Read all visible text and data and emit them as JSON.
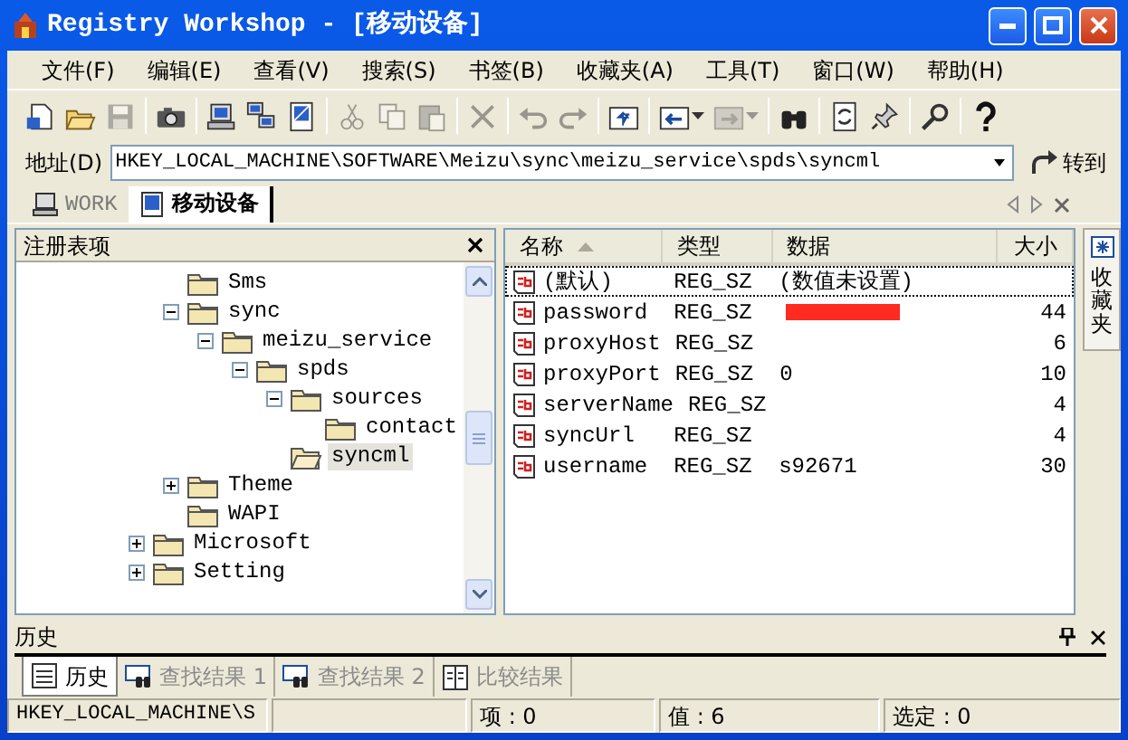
{
  "window": {
    "title": "Registry Workshop - [移动设备]"
  },
  "menu": [
    "文件(F)",
    "编辑(E)",
    "查看(V)",
    "搜索(S)",
    "书签(B)",
    "收藏夹(A)",
    "工具(T)",
    "窗口(W)",
    "帮助(H)"
  ],
  "toolbar": [
    {
      "kind": "button",
      "disabled": false
    },
    {
      "kind": "button",
      "disabled": false
    },
    {
      "kind": "button",
      "disabled": true
    },
    {
      "kind": "separator"
    },
    {
      "kind": "button",
      "disabled": false
    },
    {
      "kind": "separator"
    },
    {
      "kind": "button",
      "disabled": false
    },
    {
      "kind": "button",
      "disabled": false
    },
    {
      "kind": "button",
      "disabled": false
    },
    {
      "kind": "separator"
    },
    {
      "kind": "button",
      "disabled": true
    },
    {
      "kind": "button",
      "disabled": true
    },
    {
      "kind": "button",
      "disabled": true
    },
    {
      "kind": "separator"
    },
    {
      "kind": "button",
      "disabled": true
    },
    {
      "kind": "separator"
    },
    {
      "kind": "button",
      "disabled": true
    },
    {
      "kind": "button",
      "disabled": true
    },
    {
      "kind": "separator"
    },
    {
      "kind": "button",
      "disabled": false
    },
    {
      "kind": "separator"
    },
    {
      "kind": "dropdown",
      "disabled": false
    },
    {
      "kind": "dropdown",
      "disabled": true
    },
    {
      "kind": "separator"
    },
    {
      "kind": "button",
      "disabled": false
    },
    {
      "kind": "separator"
    },
    {
      "kind": "button",
      "disabled": false
    },
    {
      "kind": "button",
      "disabled": false
    },
    {
      "kind": "separator"
    },
    {
      "kind": "button",
      "disabled": false
    },
    {
      "kind": "separator"
    },
    {
      "kind": "button",
      "disabled": false
    }
  ],
  "address": {
    "label": "地址(D)",
    "value": "HKEY_LOCAL_MACHINE\\SOFTWARE\\Meizu\\sync\\meizu_service\\spds\\syncml",
    "go": "转到"
  },
  "document_tabs": [
    {
      "label": "WORK",
      "selected": false
    },
    {
      "label": "移动设备",
      "selected": true
    }
  ],
  "tree_panel": {
    "title": "注册表项",
    "items": [
      {
        "children": [
          {
            "label": "Sms",
            "selected": false
          },
          {
            "label": "sync",
            "selected": false,
            "expanded": true,
            "children": [
              {
                "label": "meizu_service",
                "selected": false,
                "expanded": true,
                "children": [
                  {
                    "label": "spds",
                    "selected": false,
                    "expanded": true,
                    "children": [
                      {
                        "label": "sources",
                        "selected": false,
                        "expanded": true,
                        "children": [
                          {
                            "label": "contact",
                            "selected": false
                          }
                        ]
                      },
                      {
                        "label": "syncml",
                        "selected": true
                      }
                    ]
                  }
                ]
              }
            ]
          },
          {
            "label": "Theme",
            "selected": false,
            "expanded": false
          },
          {
            "label": "WAPI",
            "selected": false
          }
        ]
      },
      {
        "label": "Microsoft",
        "selected": false,
        "expanded": false
      },
      {
        "label": "Setting",
        "selected": false,
        "expanded": false
      }
    ]
  },
  "values_table": {
    "columns": [
      {
        "label": "名称",
        "sorted": true
      },
      {
        "label": "类型",
        "sorted": false
      },
      {
        "label": "数据",
        "sorted": false
      },
      {
        "label": "大小",
        "sorted": false
      }
    ],
    "rows": [
      {
        "name": "(默认)",
        "type": "REG_SZ",
        "data": "(数值未设置)",
        "size": "",
        "focused": true,
        "redacted": false
      },
      {
        "name": "password",
        "type": "REG_SZ",
        "data": "",
        "size": "44",
        "focused": false,
        "redacted": true
      },
      {
        "name": "proxyHost",
        "type": "REG_SZ",
        "data": "",
        "size": "6",
        "focused": false,
        "redacted": false
      },
      {
        "name": "proxyPort",
        "type": "REG_SZ",
        "data": "0",
        "size": "10",
        "focused": false,
        "redacted": false
      },
      {
        "name": "serverName",
        "type": "REG_SZ",
        "data": "",
        "size": "4",
        "focused": false,
        "redacted": false
      },
      {
        "name": "syncUrl",
        "type": "REG_SZ",
        "data": "",
        "size": "4",
        "focused": false,
        "redacted": false
      },
      {
        "name": "username",
        "type": "REG_SZ",
        "data": "s92671",
        "size": "30",
        "focused": false,
        "redacted": false
      }
    ]
  },
  "favorites_tab": {
    "label": "收藏夹"
  },
  "history_panel": {
    "title": "历史"
  },
  "bottom_tabs": [
    {
      "label": "历史",
      "selected": true
    },
    {
      "label": "查找结果 1",
      "selected": false
    },
    {
      "label": "查找结果 2",
      "selected": false
    },
    {
      "label": "比较结果",
      "selected": false
    }
  ],
  "status_bar": [
    "HKEY_LOCAL_MACHINE\\S",
    "项 : 0",
    "值 : 6",
    "选定 : 0"
  ]
}
